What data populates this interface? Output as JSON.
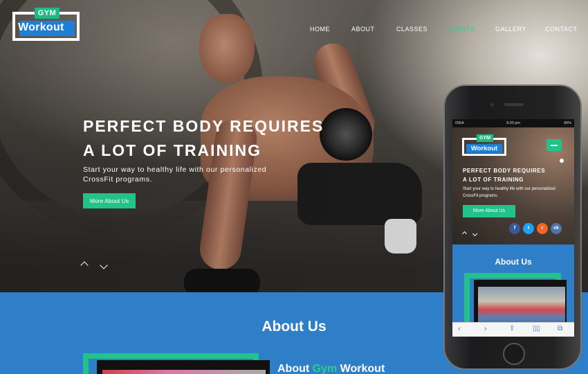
{
  "logo": {
    "top_word": "GYM",
    "main_word": "Workout"
  },
  "nav": {
    "items": [
      {
        "label": "HOME",
        "active": false
      },
      {
        "label": "ABOUT",
        "active": false
      },
      {
        "label": "CLASSES",
        "active": false
      },
      {
        "label": "CLIENTS",
        "active": true
      },
      {
        "label": "GALLERY",
        "active": false
      },
      {
        "label": "CONTACT",
        "active": false
      }
    ]
  },
  "hero": {
    "headline_line1": "PERFECT BODY REQUIRES",
    "headline_line2": "A LOT OF TRAINING",
    "subtitle_line1": "Start your way to healthy life with our personalized",
    "subtitle_line2": "CrossFit programs.",
    "cta_label": "More About Us"
  },
  "about": {
    "title": "About Us",
    "subtitle_prefix": "About ",
    "subtitle_highlight": "Gym",
    "subtitle_suffix": " Workout"
  },
  "mobile": {
    "status": {
      "carrier": "IDEA",
      "time": "9:20 pm",
      "battery": "90%"
    },
    "logo_top": "GYM",
    "logo_main": "Workout",
    "headline_line1": "PERFECT BODY REQUIRES",
    "headline_line2": "A LOT OF TRAINING",
    "subtitle": "Start your way to healthy life with our personalized CrossFit programs.",
    "cta_label": "More About Us",
    "social": [
      {
        "icon": "facebook-icon",
        "glyph": "f",
        "color": "#3b5998"
      },
      {
        "icon": "twitter-icon",
        "glyph": "t",
        "color": "#1da1f2"
      },
      {
        "icon": "rss-icon",
        "glyph": "r",
        "color": "#f26522"
      },
      {
        "icon": "vk-icon",
        "glyph": "vk",
        "color": "#4a76a8"
      }
    ],
    "about_title": "About Us"
  },
  "colors": {
    "accent_green": "#22c28a",
    "brand_blue": "#2f7fc8",
    "logo_blue": "#1e7fd6"
  }
}
